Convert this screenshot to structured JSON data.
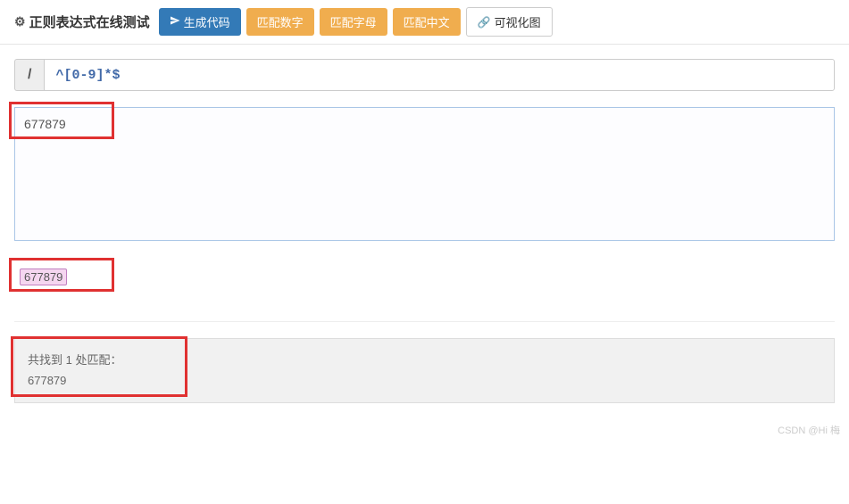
{
  "header": {
    "title": "正则表达式在线测试",
    "buttons": {
      "generate": "生成代码",
      "match_digit": "匹配数字",
      "match_letter": "匹配字母",
      "match_chinese": "匹配中文",
      "visualize": "可视化图"
    }
  },
  "regex": {
    "prefix": "/",
    "pattern": "^[0-9]*$"
  },
  "test_input": "677879",
  "result": {
    "match_value": "677879"
  },
  "summary": {
    "line1": "共找到 1 处匹配：",
    "line2": "677879"
  },
  "watermark": "CSDN @Hi 梅"
}
